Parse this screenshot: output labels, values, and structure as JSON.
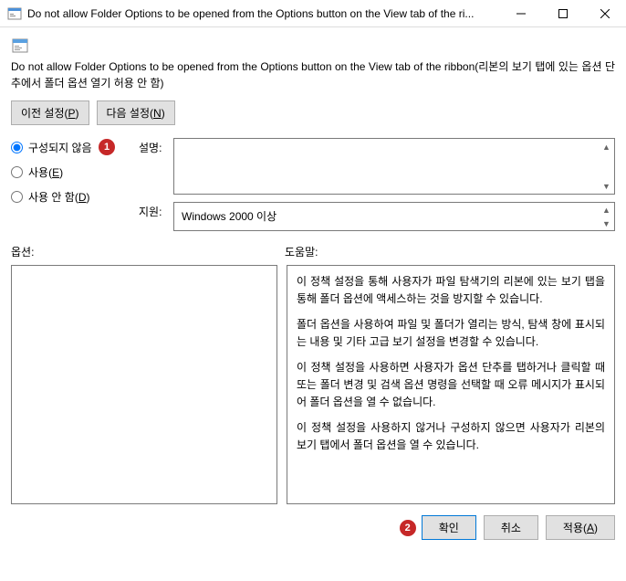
{
  "titlebar": {
    "text": "Do not allow Folder Options to be opened from the Options button on the View tab of the ri..."
  },
  "page_title": "Do not allow Folder Options to be opened from the Options button on the View tab of the ribbon(리본의 보기 탭에 있는 옵션 단추에서 폴더 옵션 열기 허용 안 함)",
  "nav": {
    "prev": "이전 설정(P)",
    "next": "다음 설정(N)"
  },
  "radios": {
    "not_configured": "구성되지 않음",
    "enabled": "사용(E)",
    "disabled": "사용 안 함(D)"
  },
  "desc": {
    "comment_label": "설명:",
    "support_label": "지원:",
    "support_text": "Windows 2000 이상"
  },
  "labels": {
    "options": "옵션:",
    "help": "도움말:"
  },
  "help": {
    "p1": "이 정책 설정을 통해 사용자가 파일 탐색기의 리본에 있는 보기 탭을 통해 폴더 옵션에 액세스하는 것을 방지할 수 있습니다.",
    "p2": "폴더 옵션을 사용하여 파일 및 폴더가 열리는 방식, 탐색 창에 표시되는 내용 및 기타 고급 보기 설정을 변경할 수 있습니다.",
    "p3": "이 정책 설정을 사용하면 사용자가 옵션 단추를 탭하거나 클릭할 때 또는 폴더 변경 및 검색 옵션 명령을 선택할 때 오류 메시지가 표시되어 폴더 옵션을 열 수 없습니다.",
    "p4": "이 정책 설정을 사용하지 않거나 구성하지 않으면 사용자가 리본의 보기 탭에서 폴더 옵션을 열 수 있습니다."
  },
  "footer": {
    "ok": "확인",
    "cancel": "취소",
    "apply": "적용(A)"
  },
  "markers": {
    "m1": "1",
    "m2": "2"
  }
}
